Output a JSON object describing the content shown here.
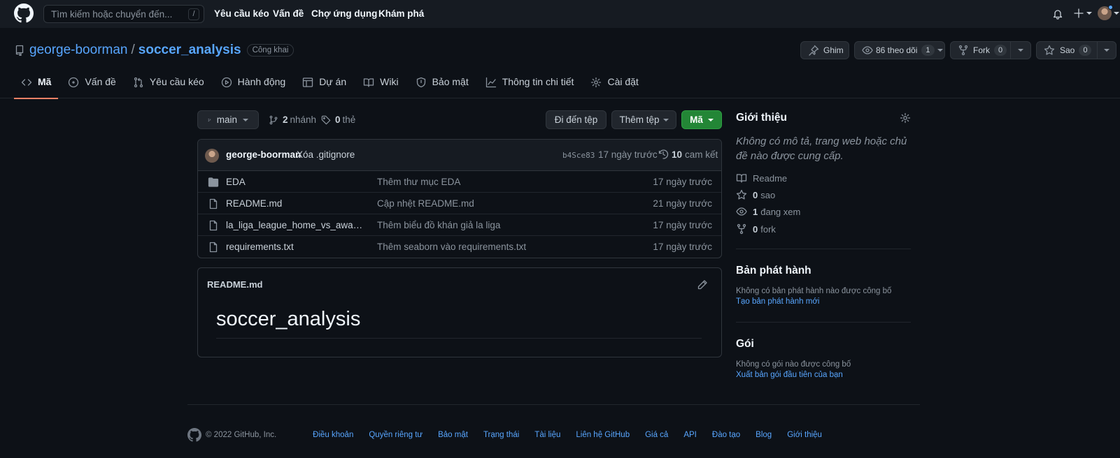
{
  "header": {
    "search_placeholder": "Tìm kiếm hoặc chuyển đến...",
    "search_shortcut": "/",
    "nav": [
      "Yêu cầu kéo",
      "Vấn đề",
      "Chợ ứng dụng",
      "Khám phá"
    ]
  },
  "repo": {
    "owner": "george-boorman",
    "separator": "/",
    "name": "soccer_analysis",
    "visibility": "Công khai",
    "actions": {
      "pin_label": "Ghim",
      "watch_label": "86 theo dõi",
      "watch_count": "1",
      "fork_label": "Fork",
      "fork_count": "0",
      "star_label": "Sao",
      "star_count": "0"
    },
    "tabs": [
      {
        "label": "Mã",
        "icon": "code-icon",
        "active": true
      },
      {
        "label": "Vấn đề",
        "icon": "issue-icon"
      },
      {
        "label": "Yêu cầu kéo",
        "icon": "pull-request-icon"
      },
      {
        "label": "Hành động",
        "icon": "play-icon"
      },
      {
        "label": "Dự án",
        "icon": "table-icon"
      },
      {
        "label": "Wiki",
        "icon": "book-icon"
      },
      {
        "label": "Bảo mật",
        "icon": "shield-icon"
      },
      {
        "label": "Thông tin chi tiết",
        "icon": "graph-icon"
      },
      {
        "label": "Cài đặt",
        "icon": "gear-icon"
      }
    ]
  },
  "code": {
    "branch": "main",
    "branches_count": "2",
    "branches_label": "nhánh",
    "tags_count": "0",
    "tags_label": "thẻ",
    "goto_file": "Đi đến tệp",
    "add_file": "Thêm tệp",
    "code_button": "Mã"
  },
  "commit": {
    "author": "george-boorman",
    "message": "Xóa .gitignore",
    "sha": "b4Sce83",
    "time": "17 ngày trước",
    "commits_count": "10",
    "commits_label": "cam kết"
  },
  "files": [
    {
      "type": "folder",
      "name": "EDA",
      "message": "Thêm thư mục EDA",
      "time": "17 ngày trước"
    },
    {
      "type": "file",
      "name": "README.md",
      "message": "Cập nhệt README.md",
      "time": "21 ngày trước"
    },
    {
      "type": "file",
      "name": "la_liga_league_home_vs_away_att...",
      "message": "Thêm biểu đồ khán giả la liga",
      "time": "17 ngày trước"
    },
    {
      "type": "file",
      "name": "requirements.txt",
      "message": "Thêm seaborn vào requirements.txt",
      "time": "17 ngày trước"
    }
  ],
  "readme": {
    "filename": "README.md",
    "heading": "soccer_analysis"
  },
  "sidebar": {
    "about_title": "Giới thiệu",
    "description": "Không có mô tả, trang web hoặc chủ đề nào được cung cấp.",
    "readme": "Readme",
    "stars_count": "0",
    "stars_label": "sao",
    "watching_count": "1",
    "watching_label": "đang xem",
    "forks_count": "0",
    "forks_label": "fork",
    "releases_title": "Bản phát hành",
    "releases_text": "Không có bản phát hành nào được công bố",
    "releases_link": "Tạo bản phát hành mới",
    "packages_title": "Gói",
    "packages_text": "Không có gói nào được công bố",
    "packages_link": "Xuất bản gói đầu tiên của bạn"
  },
  "footer": {
    "copyright": "© 2022 GitHub, Inc.",
    "links": [
      "Điều khoản",
      "Quyền riêng tư",
      "Bảo mật",
      "Trạng thái",
      "Tài liệu",
      "Liên hệ GitHub",
      "Giá cả",
      "API",
      "Đào tạo",
      "Blog",
      "Giới thiệu"
    ]
  }
}
